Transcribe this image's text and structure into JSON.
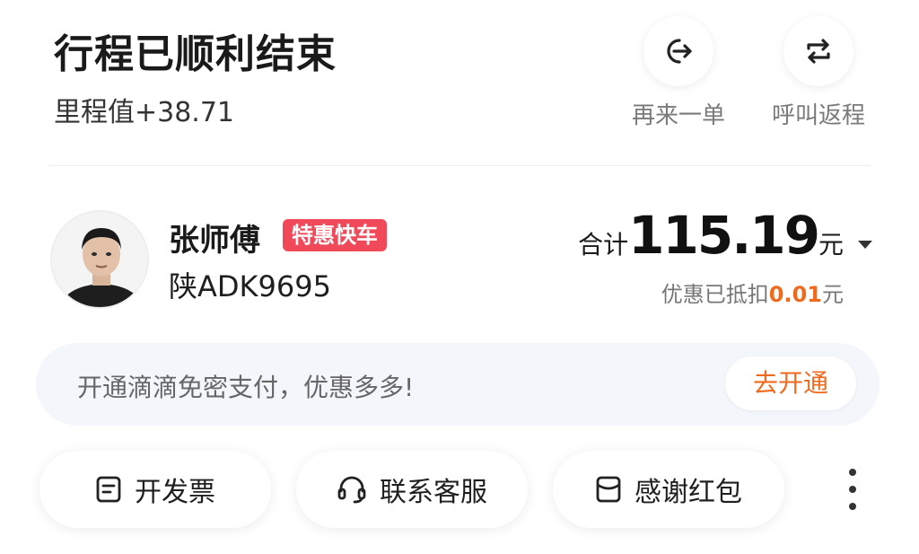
{
  "header": {
    "title": "行程已顺利结束",
    "mileage": "里程值+38.71",
    "actions": [
      {
        "label": "再来一单",
        "icon": "reorder-icon"
      },
      {
        "label": "呼叫返程",
        "icon": "return-trip-icon"
      }
    ]
  },
  "driver": {
    "name": "张师傅",
    "tag": "特惠快车",
    "plate": "陕ADK9695"
  },
  "fare": {
    "prefix": "合计",
    "amount": "115.19",
    "unit": "元",
    "discount_prefix": "优惠已抵扣",
    "discount_amount": "0.01",
    "discount_unit": "元"
  },
  "promo": {
    "text": "开通滴滴免密支付，优惠多多!",
    "button": "去开通"
  },
  "bottom_actions": [
    {
      "label": "开发票",
      "icon": "invoice-icon"
    },
    {
      "label": "联系客服",
      "icon": "headset-icon"
    },
    {
      "label": "感谢红包",
      "icon": "red-packet-icon"
    }
  ],
  "colors": {
    "accent_orange": "#f06a1e",
    "tag_red": "#f0495a",
    "banner_bg": "#f3f6fb"
  }
}
